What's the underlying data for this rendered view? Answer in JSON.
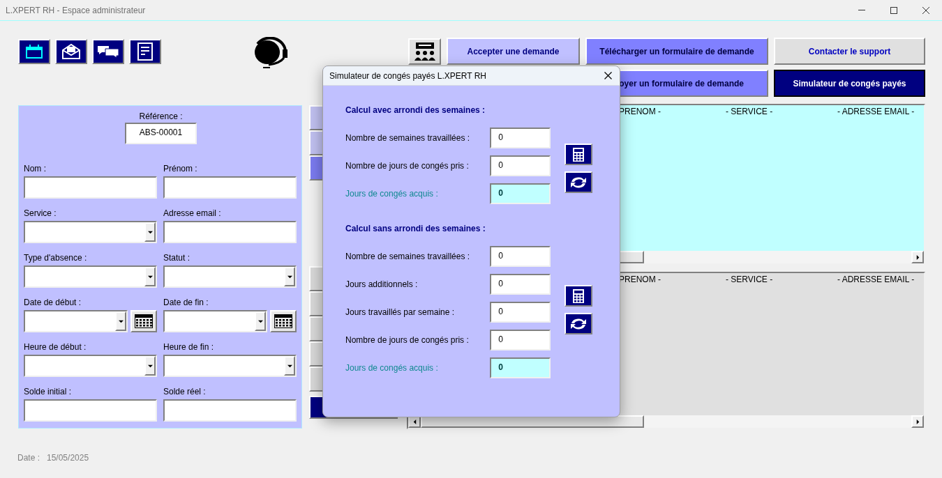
{
  "window": {
    "title": "L.XPERT RH - Espace administrateur"
  },
  "action_buttons": [
    {
      "label": "Accepter une demande",
      "kind": "light"
    },
    {
      "label": "Télécharger un formulaire de demande",
      "kind": "medium"
    },
    {
      "label": "Contacter le support",
      "kind": "grey"
    },
    {
      "label": "oyer un formulaire de demande",
      "kind": "medium"
    },
    {
      "label": "Simulateur de congés payés",
      "kind": "dark"
    }
  ],
  "form": {
    "reference_label": "Référence :",
    "reference_value": "ABS-00001",
    "fields": [
      {
        "label": "Nom :",
        "kind": "text"
      },
      {
        "label": "Prénom :",
        "kind": "text"
      },
      {
        "label": "Service :",
        "kind": "dropdown"
      },
      {
        "label": "Adresse email :",
        "kind": "text"
      },
      {
        "label": "Type d'absence :",
        "kind": "dropdown"
      },
      {
        "label": "Statut :",
        "kind": "dropdown"
      },
      {
        "label": "Date de début :",
        "kind": "date"
      },
      {
        "label": "Date de fin :",
        "kind": "date"
      },
      {
        "label": "Heure de début :",
        "kind": "dropdown"
      },
      {
        "label": "Heure de fin :",
        "kind": "dropdown"
      },
      {
        "label": "Solde initial :",
        "kind": "text"
      },
      {
        "label": "Solde réel :",
        "kind": "text"
      }
    ]
  },
  "side_buttons": [
    {
      "kind": "light"
    },
    {
      "kind": "light"
    },
    {
      "kind": "medium"
    },
    {
      "kind": "gap"
    },
    {
      "kind": "grey"
    },
    {
      "kind": "grey"
    },
    {
      "kind": "grey"
    },
    {
      "kind": "grey"
    },
    {
      "kind": "grey"
    },
    {
      "kind": "dark"
    }
  ],
  "lists": [
    {
      "color": "#c0ffff",
      "columns": [
        "PRENOM -",
        "- SERVICE -",
        "- ADRESSE EMAIL -"
      ]
    },
    {
      "color": "#e0e0e0",
      "columns": [
        "PRENOM -",
        "- SERVICE -",
        "- ADRESSE EMAIL -"
      ]
    }
  ],
  "footer": {
    "label": "Date :",
    "value": "15/05/2025"
  },
  "dialog": {
    "title": "Simulateur de congés payés L.XPERT RH",
    "sections": [
      {
        "heading": "Calcul avec arrondi des semaines :",
        "rows": [
          {
            "label": "Nombre de semaines travaillées :",
            "value": "0",
            "kind": "input"
          },
          {
            "label": "Nombre de jours de congés pris :",
            "value": "0",
            "kind": "input"
          },
          {
            "label": "Jours de congés acquis :",
            "value": "0",
            "kind": "result"
          }
        ]
      },
      {
        "heading": "Calcul sans arrondi des semaines :",
        "rows": [
          {
            "label": "Nombre de semaines travaillées :",
            "value": "0",
            "kind": "input"
          },
          {
            "label": "Jours additionnels :",
            "value": "0",
            "kind": "input"
          },
          {
            "label": "Jours travaillés par semaine :",
            "value": "0",
            "kind": "input"
          },
          {
            "label": "Nombre de jours de congés pris :",
            "value": "0",
            "kind": "input"
          },
          {
            "label": "Jours de congés acquis :",
            "value": "0",
            "kind": "result"
          }
        ]
      }
    ]
  }
}
